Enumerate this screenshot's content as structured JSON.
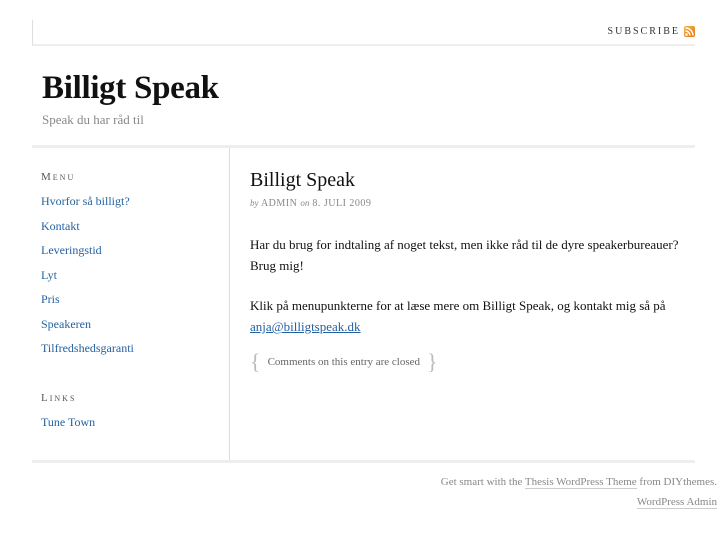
{
  "topnav": {
    "subscribe_label": "Subscribe",
    "subscribe_icon": "rss-feed-icon",
    "rss_color": "#f39a2b"
  },
  "header": {
    "site_title": "Billigt Speak",
    "tagline": "Speak du har råd til"
  },
  "sidebar": {
    "menu_heading": "Menu",
    "menu_items": [
      {
        "label": "Hvorfor så billigt?"
      },
      {
        "label": "Kontakt"
      },
      {
        "label": "Leveringstid"
      },
      {
        "label": "Lyt"
      },
      {
        "label": "Pris"
      },
      {
        "label": "Speakeren"
      },
      {
        "label": "Tilfredshedsgaranti"
      }
    ],
    "links_heading": "Links",
    "links": [
      {
        "label": "Tune Town"
      }
    ]
  },
  "post": {
    "title": "Billigt Speak",
    "by_word": "by",
    "author": "ADMIN",
    "on_word": "on",
    "date": "8. JULI 2009",
    "paragraph1": "Har du brug for indtaling af noget tekst, men ikke råd til de dyre speakerbureauer? Brug mig!",
    "paragraph2_text": "Klik på menupunkterne for at læse mere om Billigt Speak, og kontakt mig så på ",
    "email_link": "anja@billigtspeak.dk",
    "comments_status": "Comments on this entry are closed"
  },
  "footer": {
    "prefix": "Get smart with the ",
    "theme_link": "Thesis WordPress Theme",
    "suffix": " from DIYthemes.",
    "admin_link": "WordPress Admin"
  },
  "colors": {
    "link": "#2361a1",
    "muted_text": "#888888",
    "divider": "#eeeeee"
  }
}
